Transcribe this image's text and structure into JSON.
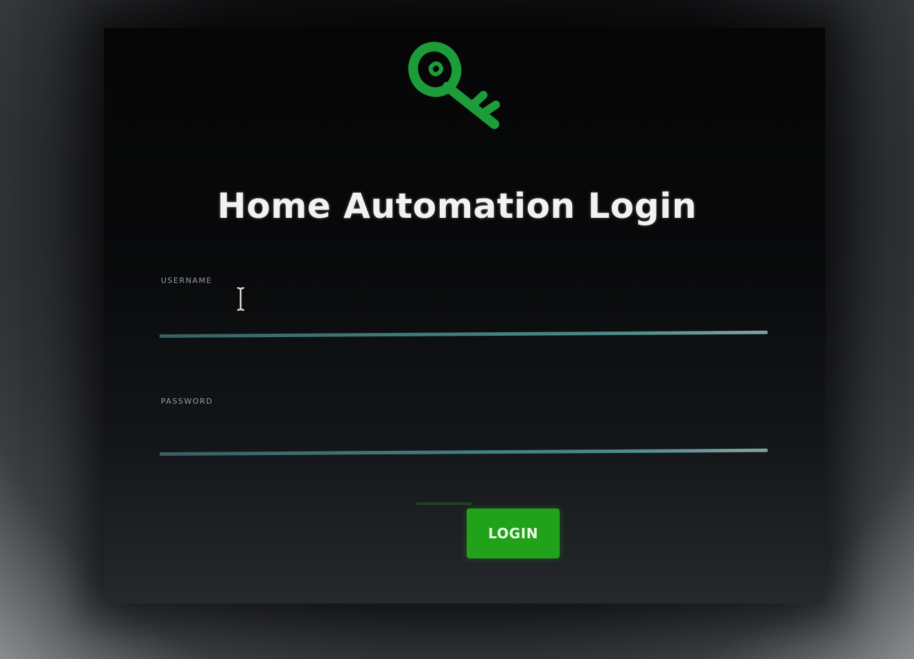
{
  "app": {
    "title": "Home Automation Login",
    "accent_color": "#21a21a",
    "logo_icon": "key-icon",
    "logo_color": "#1e9e3c"
  },
  "form": {
    "username": {
      "label": "USERNAME",
      "value": "",
      "placeholder": ""
    },
    "password": {
      "label": "PASSWORD",
      "value": "",
      "placeholder": ""
    },
    "submit_label": "LOGIN"
  },
  "cursor": {
    "type": "text-cursor-icon"
  }
}
